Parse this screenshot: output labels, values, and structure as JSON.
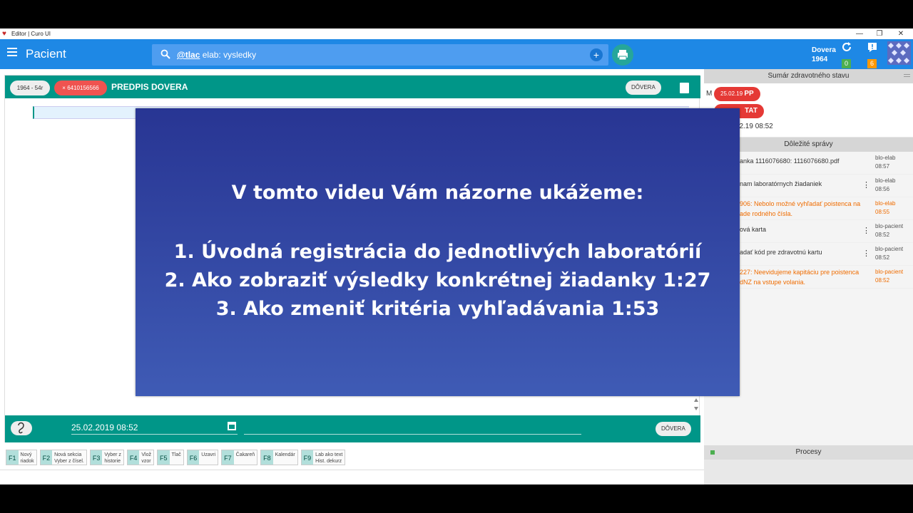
{
  "window": {
    "title": "Editor | Curo UI",
    "controls": [
      "—",
      "❐",
      "✕"
    ]
  },
  "appbar": {
    "title": "Pacient",
    "search_prefix": "@tlac",
    "search_text": " elab: vysledky",
    "add_label": "+",
    "user_name": "Dovera",
    "user_year": "1964",
    "sync_count": "0",
    "alert_count": "6",
    "colors": {
      "bar": "#1e88e5",
      "sync_badge": "#4caf50",
      "alert_badge": "#ff9800",
      "print": "#26a69a"
    }
  },
  "editor": {
    "chip_age": "1964 - 54r",
    "chip_id_close": "×",
    "chip_id": "6410156566",
    "title": "PREDPIS DOVERA",
    "header_pill": "DÔVERA",
    "footer_date": "25.02.2019 08:52",
    "footer_pill": "DÔVERA",
    "colors": {
      "header": "#009688",
      "id_chip": "#ef5350"
    }
  },
  "fkeys": [
    {
      "key": "F1",
      "label": "Nový\nriadok"
    },
    {
      "key": "F2",
      "label": "Nová sekcia\nVyber z čísel."
    },
    {
      "key": "F3",
      "label": "Vyber z\nhistorie"
    },
    {
      "key": "F4",
      "label": "Vlož\nvzor"
    },
    {
      "key": "F5",
      "label": "Tlač"
    },
    {
      "key": "F6",
      "label": "Uzavri"
    },
    {
      "key": "F7",
      "label": "Čakareň"
    },
    {
      "key": "F8",
      "label": "Kalendár"
    },
    {
      "key": "F9",
      "label": "Lab ako text\nHist. dekurz"
    }
  ],
  "right_panel": {
    "summary_title": "Sumár zdravotného stavu",
    "summary_letter": "M",
    "chips": [
      {
        "date": "25.02.19",
        "code": "PP"
      },
      {
        "date": "",
        "code": "TAT"
      }
    ],
    "summary_date": "25.02.19 08:52",
    "messages_title": "Dôležité správy",
    "messages": [
      {
        "text": "anka 1116076680: 1116076680.pdf",
        "source": "blo-elab",
        "time": "08:57",
        "error": false,
        "menu": false
      },
      {
        "text": "nam laboratórnych žiadaniek",
        "source": "blo-elab",
        "time": "08:56",
        "error": false,
        "menu": true
      },
      {
        "text": "906: Nebolo možné vyhľadať poistenca na\nade rodného čísla.",
        "source": "blo-elab",
        "time": "08:55",
        "error": true,
        "menu": false
      },
      {
        "text": "ová karta",
        "source": "blo-pacient",
        "time": "08:52",
        "error": false,
        "menu": true
      },
      {
        "text": "adať kód pre zdravotnú kartu",
        "source": "blo-pacient",
        "time": "08:52",
        "error": false,
        "menu": true
      },
      {
        "text": "227: Neevidujeme kapitáciu pre poistenca\ndNZ na vstupe volania.",
        "source": "blo-pacient",
        "time": "08:52",
        "error": true,
        "menu": false
      }
    ],
    "procesy_title": "Procesy"
  },
  "overlay": {
    "heading": "V tomto videu Vám názorne ukážeme:",
    "items": [
      "1. Úvodná registrácia do jednotlivých laboratórií",
      "2. Ako zobraziť výsledky konkrétnej žiadanky 1:27",
      "3. Ako zmeniť kritéria vyhľadávania 1:53"
    ]
  }
}
